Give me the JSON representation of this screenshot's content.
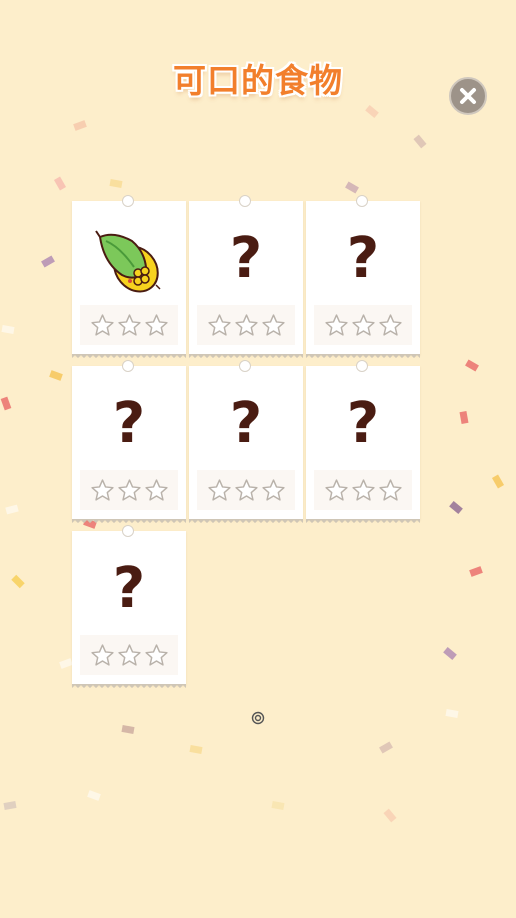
{
  "title": "可口的食物",
  "close_icon": "close-x-icon",
  "cards": [
    {
      "label": "",
      "unlocked": true,
      "stars": 0,
      "icon": "corn-icon"
    },
    {
      "label": "?",
      "unlocked": false,
      "stars": 0
    },
    {
      "label": "?",
      "unlocked": false,
      "stars": 0
    },
    {
      "label": "?",
      "unlocked": false,
      "stars": 0
    },
    {
      "label": "?",
      "unlocked": false,
      "stars": 0
    },
    {
      "label": "?",
      "unlocked": false,
      "stars": 0
    },
    {
      "label": "?",
      "unlocked": false,
      "stars": 0
    }
  ],
  "colors": {
    "background": "#fdeecb",
    "title": "#f27f2c",
    "question_mark": "#4a1c12",
    "star_outline": "#b9b2aa",
    "close_button": "#9d9389"
  }
}
